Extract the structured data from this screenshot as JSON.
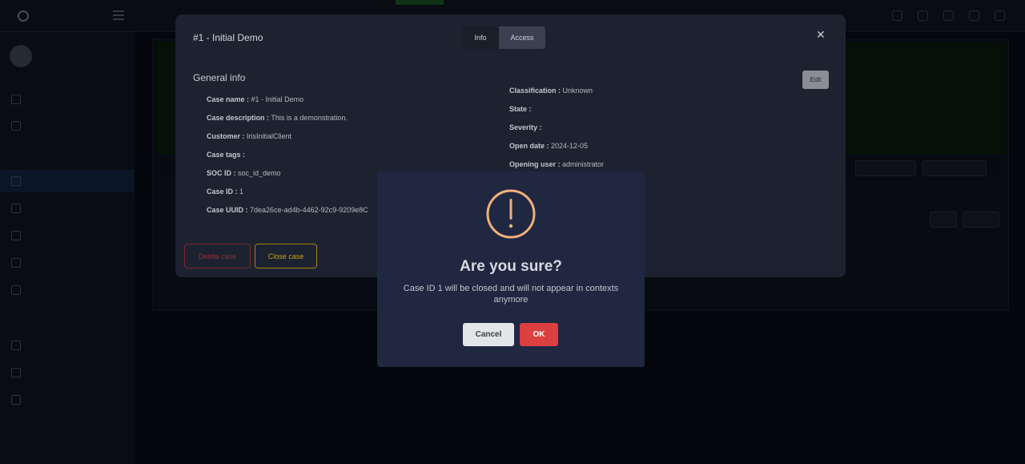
{
  "colors": {
    "modal_bg": "#1d2230",
    "confirm_bg": "#1f2741",
    "warning_orange": "#f0b07a",
    "ok_red": "#dc3f3f",
    "delete_red": "#7a2a2a",
    "close_yellow": "#c7a21a"
  },
  "case_modal": {
    "title": "#1 - Initial Demo",
    "tabs": [
      {
        "label": "Info",
        "icon": ""
      },
      {
        "label": "Access",
        "icon": ""
      }
    ],
    "close_icon": "close-icon",
    "section_title": "General info",
    "edit_label": "Edit",
    "left_fields": [
      {
        "label": "Case name :",
        "value": "#1 - Initial Demo"
      },
      {
        "label": "Case description :",
        "value": "This is a demonstration."
      },
      {
        "label": "Customer :",
        "value": "IrisInitialClient"
      },
      {
        "label": "Case tags :",
        "value": ""
      },
      {
        "label": "SOC ID :",
        "value": "soc_id_demo"
      },
      {
        "label": "Case ID :",
        "value": "1"
      },
      {
        "label": "Case UUID :",
        "value": "7dea26ce-ad4b-4462-92c9-9209e8C"
      }
    ],
    "right_fields": [
      {
        "label": "Classification :",
        "value": "Unknown"
      },
      {
        "label": "State :",
        "value": ""
      },
      {
        "label": "Severity :",
        "value": ""
      },
      {
        "label": "Open date :",
        "value": "2024-12-05"
      },
      {
        "label": "Opening user :",
        "value": "administrator"
      }
    ],
    "delete_label": "Delete case",
    "close_case_label": "Close case"
  },
  "confirm_dialog": {
    "icon": "exclamation-icon",
    "title": "Are you sure?",
    "message": "Case ID 1 will be closed and will not appear in contexts anymore",
    "cancel_label": "Cancel",
    "ok_label": "OK"
  }
}
